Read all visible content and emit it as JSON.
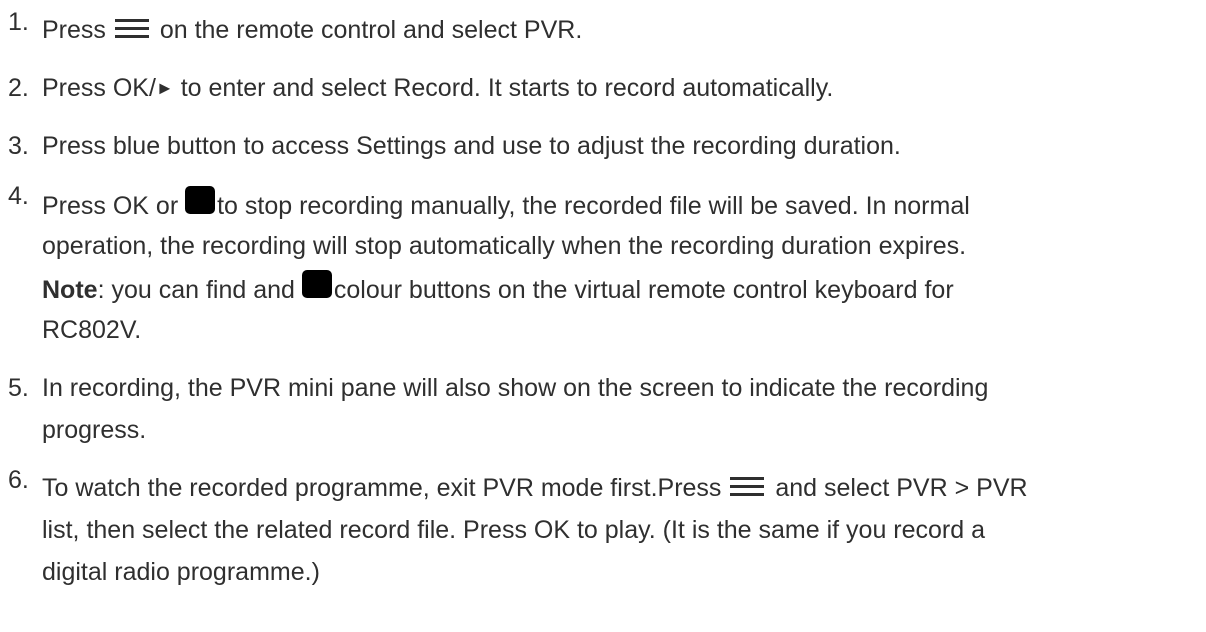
{
  "steps": [
    {
      "number": "1.",
      "lines": [
        {
          "a": "Press",
          "b": "on the remote control and select PVR."
        }
      ]
    },
    {
      "number": "2.",
      "lines": [
        {
          "a": "Press OK/",
          "play": "►",
          "b": " to enter and select Record. It starts to record automatically."
        }
      ]
    },
    {
      "number": "3.",
      "lines": [
        {
          "text": "Press blue button to access Settings and use to adjust the recording duration."
        }
      ]
    },
    {
      "number": "4.",
      "lines": [
        {
          "a": "Press OK or ",
          "b": "to stop recording manually, the recorded file will be saved. In normal"
        },
        {
          "text": "operation, the recording will stop automatically when the recording duration expires."
        },
        {
          "note_label": "Note",
          "a": ": you can find and ",
          "b": "colour buttons on the virtual remote control keyboard for"
        },
        {
          "text": "RC802V."
        }
      ]
    },
    {
      "number": "5.",
      "lines": [
        {
          "text": "In recording, the PVR mini pane will also show on the screen to indicate the recording"
        },
        {
          "text": "progress."
        }
      ]
    },
    {
      "number": "6.",
      "lines": [
        {
          "a": "To watch the recorded programme, exit PVR mode first.Press ",
          "b": "and select PVR > PVR"
        },
        {
          "text": "list, then select the related record file. Press OK to play. (It is the same if you record a"
        },
        {
          "text": "digital radio programme.)"
        }
      ]
    }
  ],
  "icons": {
    "menu": "hamburger-menu-icon",
    "stop": "stop-button-icon",
    "play": "play-triangle-icon"
  }
}
